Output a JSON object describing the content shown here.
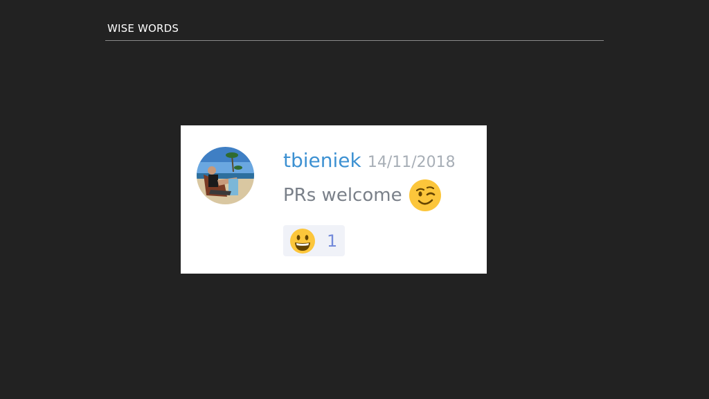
{
  "slide": {
    "title": "WISE WORDS"
  },
  "message": {
    "username": "tbieniek",
    "timestamp": "14/11/2018",
    "text": "PRs welcome",
    "inline_emoji": "winking-face",
    "avatar_description": "man-on-beach-chair"
  },
  "reaction": {
    "emoji": "smiling-face-with-open-mouth",
    "count": "1"
  },
  "colors": {
    "background": "#222222",
    "card": "#ffffff",
    "username": "#3d91d2",
    "timestamp": "#a7aeb6",
    "message_text": "#7a8089",
    "reaction_bg": "#f0f2f8",
    "reaction_count": "#7289da",
    "emoji_yellow": "#fcc63b"
  }
}
